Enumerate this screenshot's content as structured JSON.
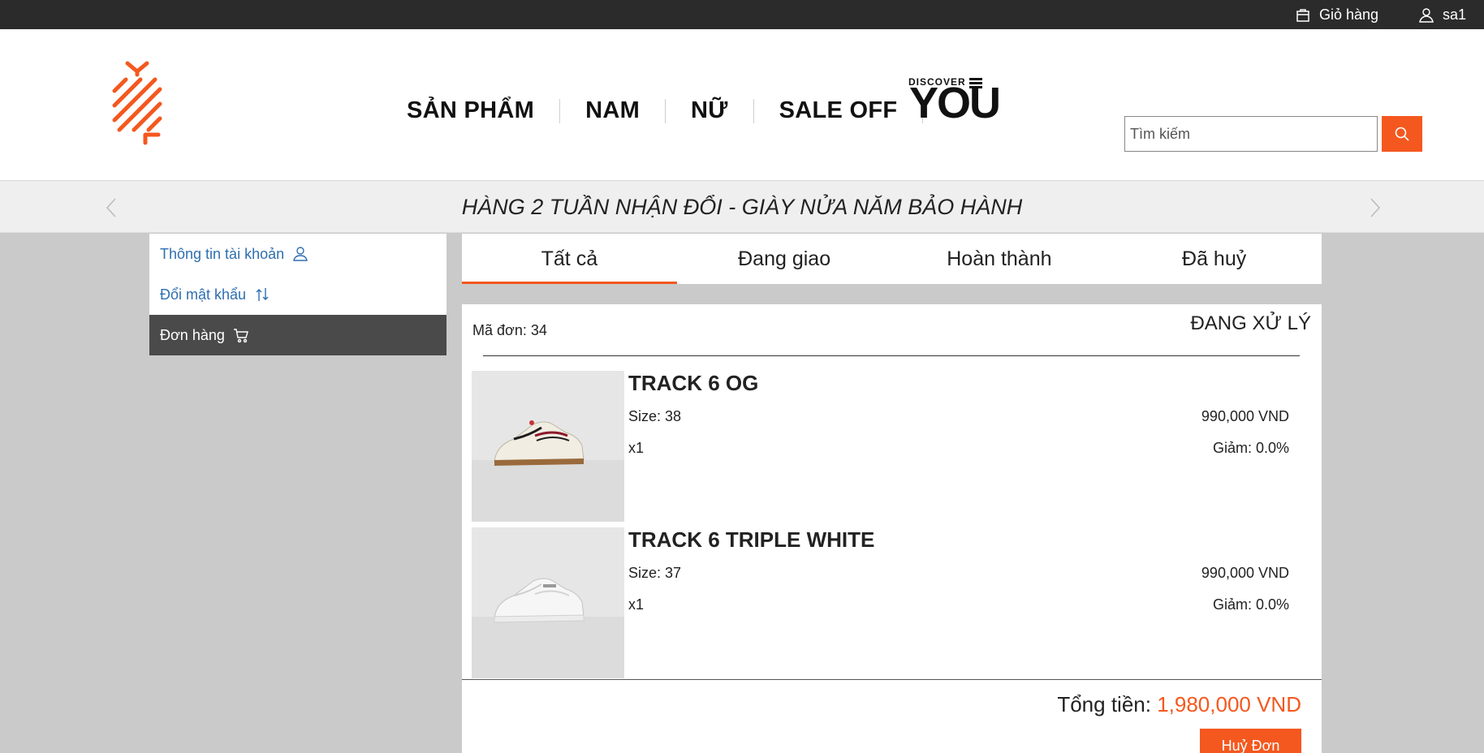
{
  "topbar": {
    "cart_label": "Giỏ hàng",
    "cart_icon": "shopping-bag-icon",
    "user_label": "sa1",
    "user_icon": "user-icon"
  },
  "header": {
    "logo": "brand-logo",
    "nav": [
      {
        "label": "SẢN PHẨM"
      },
      {
        "label": "NAM"
      },
      {
        "label": "NỮ"
      },
      {
        "label": "SALE OFF"
      }
    ],
    "discover": {
      "small": "DISCOVER",
      "big": "YOU"
    },
    "search": {
      "placeholder": "Tìm kiếm",
      "value": "",
      "icon": "search-icon"
    }
  },
  "banner": {
    "text": "HÀNG 2 TUẦN NHẬN ĐỔI - GIÀY NỬA NĂM BẢO HÀNH"
  },
  "sidebar": {
    "items": [
      {
        "label": "Thông tin tài khoản",
        "icon": "user-icon",
        "active": false
      },
      {
        "label": "Đổi mật khẩu",
        "icon": "swap-arrows-icon",
        "active": false
      },
      {
        "label": "Đơn hàng",
        "icon": "cart-icon",
        "active": true
      }
    ]
  },
  "tabs": [
    {
      "label": "Tất cả",
      "active": true
    },
    {
      "label": "Đang giao",
      "active": false
    },
    {
      "label": "Hoàn thành",
      "active": false
    },
    {
      "label": "Đã huỷ",
      "active": false
    }
  ],
  "order": {
    "code": "Mã đơn: 34",
    "status": "ĐANG XỬ LÝ",
    "items": [
      {
        "name": "TRACK 6 OG",
        "size": "Size: 38",
        "qty": "x1",
        "price": "990,000  VND",
        "discount": "Giảm: 0.0%"
      },
      {
        "name": "TRACK 6 TRIPLE WHITE",
        "size": "Size: 37",
        "qty": "x1",
        "price": "990,000  VND",
        "discount": "Giảm: 0.0%"
      }
    ],
    "total_label": "Tổng tiền: ",
    "total_amount": "1,980,000  VND",
    "cancel_label": "Huỷ Đơn"
  },
  "colors": {
    "accent": "#f4581f",
    "topbar": "#2b2b2b",
    "link": "#2f6fb0",
    "active_sidebar": "#4a4a4a",
    "page_bg": "#cacaca"
  }
}
